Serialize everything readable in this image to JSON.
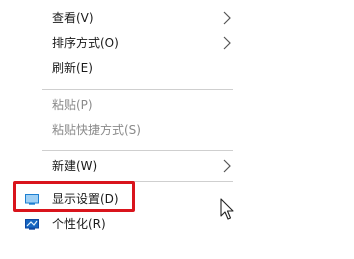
{
  "context_menu": {
    "items": [
      {
        "label": "查看(V)"
      },
      {
        "label": "排序方式(O)"
      },
      {
        "label": "刷新(E)"
      },
      {
        "label": "粘贴(P)"
      },
      {
        "label": "粘贴快捷方式(S)"
      },
      {
        "label": "新建(W)"
      },
      {
        "label": "显示设置(D)"
      },
      {
        "label": "个性化(R)"
      }
    ]
  },
  "colors": {
    "highlight_border": "#d9141c",
    "disabled_text": "#8a8a8a",
    "separator": "#cfcfcf",
    "display_icon": "#1d7fd1",
    "personalize_icon": "#1565c0"
  },
  "icons": {
    "submenu_arrow": "chevron-right-icon",
    "display_settings": "monitor-icon",
    "personalize": "personalize-monitor-icon",
    "pointer": "mouse-cursor-icon"
  }
}
